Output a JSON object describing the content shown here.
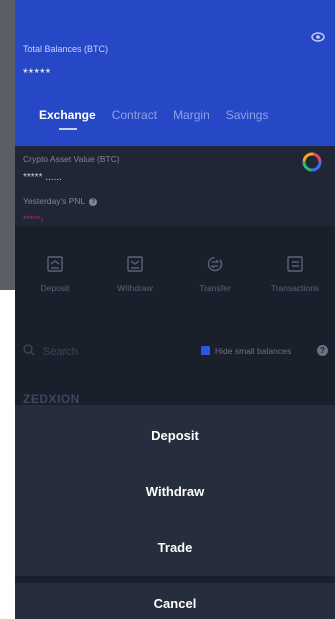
{
  "header": {
    "total_balances_label": "Total Balances (BTC)",
    "total_balances_value": "*****",
    "tabs": [
      {
        "label": "Exchange"
      },
      {
        "label": "Contract"
      },
      {
        "label": "Margin"
      },
      {
        "label": "Savings"
      }
    ]
  },
  "assets": {
    "crypto_asset_label": "Crypto Asset Value (BTC)",
    "crypto_asset_value": "***** ......",
    "pnl_label": "Yesterday's PNL",
    "pnl_value": "*****"
  },
  "actions": [
    {
      "label": "Deposit",
      "icon": "deposit-icon"
    },
    {
      "label": "Withdraw",
      "icon": "withdraw-icon"
    },
    {
      "label": "Transfer",
      "icon": "transfer-icon"
    },
    {
      "label": "Transactions",
      "icon": "transactions-icon"
    }
  ],
  "search": {
    "placeholder": "Search",
    "hide_small_label": "Hide small balances"
  },
  "coin_list": {
    "first_name": "ZEDXION"
  },
  "sheet": {
    "options": [
      "Deposit",
      "Withdraw",
      "Trade"
    ],
    "cancel_label": "Cancel"
  },
  "colors": {
    "accent": "#2748c6",
    "background": "#1a1f2c",
    "sheet": "#262d3d",
    "negative": "#a8334c"
  }
}
